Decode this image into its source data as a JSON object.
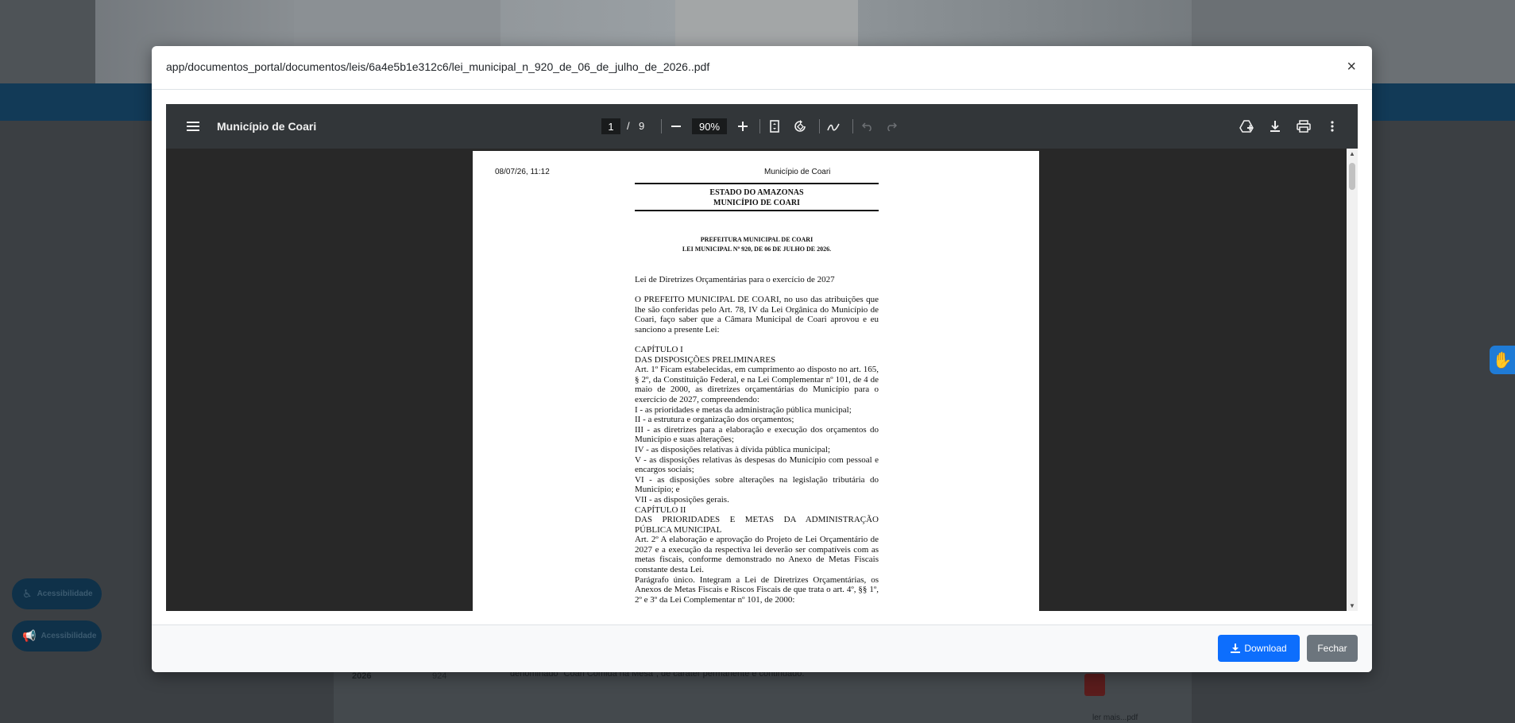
{
  "background": {
    "table_row": {
      "year": "2026",
      "number": "924",
      "summary": "denominado \"Coari Comida na Mesa\", de caráter permanente e continuado."
    },
    "table_row_next": {
      "label": "ler mais...pdf"
    },
    "accessibility_buttons": [
      "Acessibilidade",
      "Acessibilidade"
    ]
  },
  "modal": {
    "title": "app/documentos_portal/documentos/leis/6a4e5b1e312c6/lei_municipal_n_920_de_06_de_julho_de_2026..pdf",
    "close_symbol": "×",
    "download_label": "Download",
    "close_label": "Fechar"
  },
  "viewer": {
    "document_title": "Município de Coari",
    "current_page": "1",
    "page_separator": "/",
    "total_pages": "9",
    "zoom": "90%"
  },
  "page": {
    "print_date": "08/07/26, 11:12",
    "site_title": "Município de Coari",
    "header_line1": "ESTADO DO AMAZONAS",
    "header_line2": "MUNICÍPIO DE COARI",
    "sub_line1": "PREFEITURA MUNICIPAL DE COARI",
    "sub_line2": "LEI MUNICIPAL Nº 920, DE 06 DE JULHO DE 2026.",
    "subject": "Lei de Diretrizes Orçamentárias para o exercício de 2027",
    "preamble": "O PREFEITO MUNICIPAL DE COARI, no uso das atribuições que lhe são conferidas pelo Art. 78, IV da Lei Orgânica do Município de Coari, faço saber que a Câmara Municipal de Coari aprovou e eu sanciono a presente Lei:",
    "body_lines": [
      "CAPÍTULO I",
      "DAS DISPOSIÇÕES PRELIMINARES",
      "Art. 1º Ficam estabelecidas, em cumprimento ao disposto no art. 165, § 2º, da Constituição Federal, e na Lei Complementar nº 101, de 4 de maio de 2000, as diretrizes orçamentárias do Município para o exercício de 2027, compreendendo:",
      "I - as prioridades e metas da administração pública municipal;",
      "II - a estrutura e organização dos orçamentos;",
      "III - as diretrizes para a elaboração e execução dos orçamentos do Município e suas alterações;",
      "IV - as disposições relativas à dívida pública municipal;",
      "V - as disposições relativas às despesas do Município com pessoal e encargos sociais;",
      "VI - as disposições sobre alterações na legislação tributária do Município; e",
      "VII - as disposições gerais.",
      "CAPÍTULO II",
      "DAS PRIORIDADES E METAS DA ADMINISTRAÇÃO PÚBLICA MUNICIPAL",
      "Art. 2º A elaboração e aprovação do Projeto de Lei Orçamentário de 2027 e a execução da respectiva lei deverão ser compatíveis com as metas fiscais, conforme demonstrado no Anexo de Metas Fiscais constante desta Lei.",
      "Parágrafo único. Integram a Lei de Diretrizes Orçamentárias, os Anexos de Metas Fiscais e Riscos Fiscais de que trata o art. 4º, §§ 1º, 2º e 3º da Lei Complementar nº 101, de 2000:"
    ]
  },
  "icons": {
    "menu": "menu-icon",
    "zoom_out": "minus-icon",
    "zoom_in": "plus-icon",
    "fit": "fit-page-icon",
    "rotate": "rotate-icon",
    "annotate": "pen-icon",
    "undo": "undo-icon",
    "redo": "redo-icon",
    "drive": "add-to-drive-icon",
    "download": "download-icon",
    "print": "print-icon",
    "more": "more-vert-icon"
  },
  "colors": {
    "primary": "#0d6efd",
    "secondary": "#6c757d",
    "toolbar": "#323639",
    "viewer_bg": "#282828"
  }
}
